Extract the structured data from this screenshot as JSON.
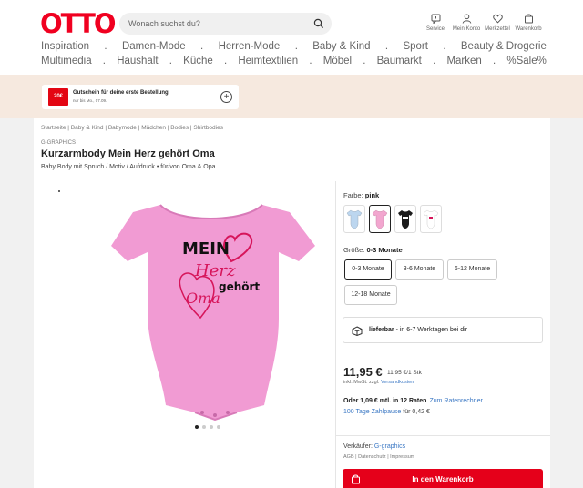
{
  "header": {
    "logo": "OTTO",
    "search_placeholder": "Wonach suchst du?",
    "icons": [
      {
        "icon": "service-icon",
        "label": "Service"
      },
      {
        "icon": "user-icon",
        "label": "Mein Konto"
      },
      {
        "icon": "heart-icon",
        "label": "Merkzettel"
      },
      {
        "icon": "cart-icon",
        "label": "Warenkorb"
      }
    ]
  },
  "nav": {
    "row1": [
      "Inspiration",
      "Damen-Mode",
      "Herren-Mode",
      "Baby & Kind",
      "Sport",
      "Beauty & Drogerie"
    ],
    "row2": [
      "Multimedia",
      "Haushalt",
      "Küche",
      "Heimtextilien",
      "Möbel",
      "Baumarkt",
      "Marken",
      "%Sale%"
    ],
    "separator": "."
  },
  "coupon": {
    "badge": "20€",
    "title": "Gutschein für deine erste Bestellung",
    "note": "nur bis Mo., 07.09."
  },
  "breadcrumb": "Startseite | Baby & Kind | Babymode | Mädchen | Bodies | Shirtbodies",
  "product": {
    "brand": "G-GRAPHICS",
    "title": "Kurzarmbody Mein Herz gehört Oma",
    "subtitle": "Baby Body mit Spruch / Motiv / Aufdruck • für/von Oma & Opa",
    "print_words": [
      "MEIN",
      "Herz",
      "gehört",
      "Oma"
    ]
  },
  "color": {
    "label": "Farbe:",
    "value": "pink",
    "swatches": [
      "#bcd6ef",
      "#f2a6cf",
      "#1c1c1c",
      "#ffffff"
    ]
  },
  "size": {
    "label": "Größe:",
    "value": "0-3 Monate",
    "options": [
      "0-3 Monate",
      "3-6 Monate",
      "6-12 Monate",
      "12-18 Monate"
    ]
  },
  "delivery": {
    "bold": "lieferbar",
    "rest": " - in 6-7 Werktagen bei dir"
  },
  "price": {
    "value": "11,95 €",
    "unit": "11,95 €/1 Stk",
    "vat_prefix": "inkl. MwSt. zzgl. ",
    "vat_link": "Versandkosten",
    "rates_bold": "Oder 1,09 € mtl. in 12 Raten",
    "rates_link": "Zum Ratenrechner",
    "pause_link": "100 Tage Zahlpause",
    "pause_rest": " für 0,42 €"
  },
  "seller": {
    "prefix": "Verkäufer: ",
    "name": "G-graphics",
    "links": "AGB | Datenschutz | Impressum"
  },
  "cart_button": "In den Warenkorb",
  "colors": {
    "brand_red": "#f00020",
    "link_blue": "#3b78c4",
    "banner_bg": "#f6e9df"
  }
}
